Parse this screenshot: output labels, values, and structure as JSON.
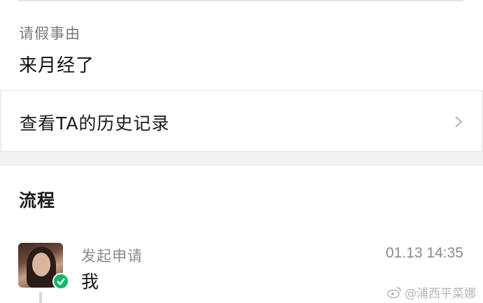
{
  "leave": {
    "reason_label": "请假事由",
    "reason_value": "来月经了"
  },
  "history": {
    "label": "查看TA的历史记录",
    "icon": "chevron-right-icon"
  },
  "process": {
    "title": "流程",
    "steps": [
      {
        "title": "发起申请",
        "user": "我",
        "time": "01.13 14:35",
        "status_icon": "check-badge-icon"
      }
    ]
  },
  "watermark": {
    "text": "@浦西平菜娜"
  },
  "colors": {
    "success": "#12b76a",
    "muted_text": "#8a8a8a",
    "background": "#f2f2f2"
  }
}
